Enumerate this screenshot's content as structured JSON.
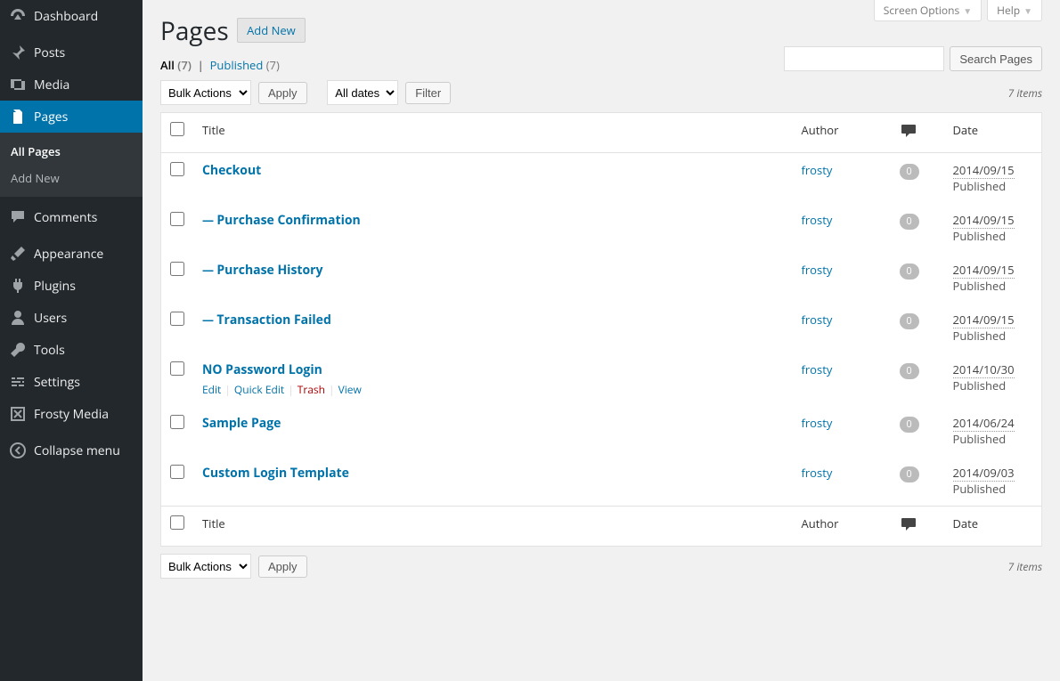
{
  "screen_tabs": {
    "options": "Screen Options",
    "help": "Help"
  },
  "sidebar": {
    "items": [
      {
        "label": "Dashboard",
        "icon": "dashboard"
      },
      {
        "label": "Posts",
        "icon": "pin"
      },
      {
        "label": "Media",
        "icon": "media"
      },
      {
        "label": "Pages",
        "icon": "pages",
        "current": true,
        "submenu": [
          {
            "label": "All Pages",
            "current": true
          },
          {
            "label": "Add New"
          }
        ]
      },
      {
        "label": "Comments",
        "icon": "comment"
      },
      {
        "label": "Appearance",
        "icon": "brush"
      },
      {
        "label": "Plugins",
        "icon": "plug"
      },
      {
        "label": "Users",
        "icon": "user"
      },
      {
        "label": "Tools",
        "icon": "wrench"
      },
      {
        "label": "Settings",
        "icon": "sliders"
      },
      {
        "label": "Frosty Media",
        "icon": "frosty"
      },
      {
        "label": "Collapse menu",
        "icon": "collapse"
      }
    ]
  },
  "header": {
    "title": "Pages",
    "add_new": "Add New"
  },
  "filters": {
    "all_label": "All",
    "all_count": "(7)",
    "published_label": "Published",
    "published_count": "(7)"
  },
  "search": {
    "placeholder": "",
    "button": "Search Pages"
  },
  "bulk": {
    "select": "Bulk Actions",
    "apply": "Apply",
    "dates": "All dates",
    "filter": "Filter"
  },
  "count_text": "7 items",
  "columns": {
    "title": "Title",
    "author": "Author",
    "date": "Date"
  },
  "row_actions": {
    "edit": "Edit",
    "quick_edit": "Quick Edit",
    "trash": "Trash",
    "view": "View"
  },
  "rows": [
    {
      "title": "Checkout",
      "child": false,
      "author": "frosty",
      "comments": "0",
      "date": "2014/09/15",
      "status": "Published",
      "hover": false
    },
    {
      "title": "Purchase Confirmation",
      "child": true,
      "author": "frosty",
      "comments": "0",
      "date": "2014/09/15",
      "status": "Published",
      "hover": false
    },
    {
      "title": "Purchase History",
      "child": true,
      "author": "frosty",
      "comments": "0",
      "date": "2014/09/15",
      "status": "Published",
      "hover": false
    },
    {
      "title": "Transaction Failed",
      "child": true,
      "author": "frosty",
      "comments": "0",
      "date": "2014/09/15",
      "status": "Published",
      "hover": false
    },
    {
      "title": "NO Password Login",
      "child": false,
      "author": "frosty",
      "comments": "0",
      "date": "2014/10/30",
      "status": "Published",
      "hover": true
    },
    {
      "title": "Sample Page",
      "child": false,
      "author": "frosty",
      "comments": "0",
      "date": "2014/06/24",
      "status": "Published",
      "hover": false
    },
    {
      "title": "Custom Login Template",
      "child": false,
      "author": "frosty",
      "comments": "0",
      "date": "2014/09/03",
      "status": "Published",
      "hover": false
    }
  ]
}
